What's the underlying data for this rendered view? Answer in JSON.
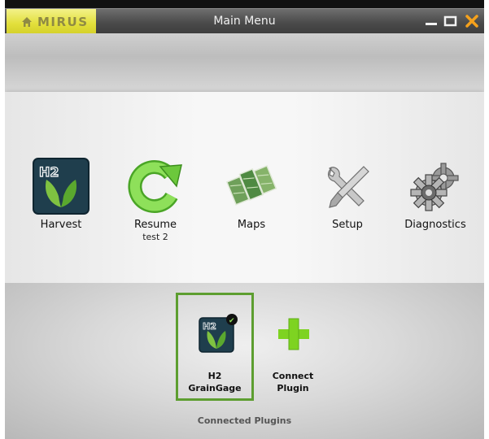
{
  "titlebar": {
    "brand": "MIRUS",
    "title": "Main Menu",
    "icons": [
      "home-icon",
      "minimize-icon",
      "maximize-icon",
      "close-icon"
    ],
    "brand_color": "#e2df3a",
    "close_color": "#f5a11c"
  },
  "menu": {
    "items": [
      {
        "label": "Harvest",
        "icon": "h2-leaf-icon"
      },
      {
        "label": "Resume",
        "sub": "test 2",
        "icon": "refresh-arrow-icon"
      },
      {
        "label": "Maps",
        "icon": "map-tiles-icon"
      },
      {
        "label": "Setup",
        "icon": "wrench-screwdriver-icon"
      },
      {
        "label": "Diagnostics",
        "icon": "gears-icon"
      }
    ]
  },
  "plugins": {
    "connected": {
      "line1": "H2",
      "line2": "GrainGage",
      "icon": "h2-leaf-check-icon",
      "badge": "✔"
    },
    "connect": {
      "line1": "Connect",
      "line2": "Plugin",
      "icon": "plus-icon"
    },
    "section_label": "Connected Plugins",
    "accent_green": "#5d9e30"
  }
}
